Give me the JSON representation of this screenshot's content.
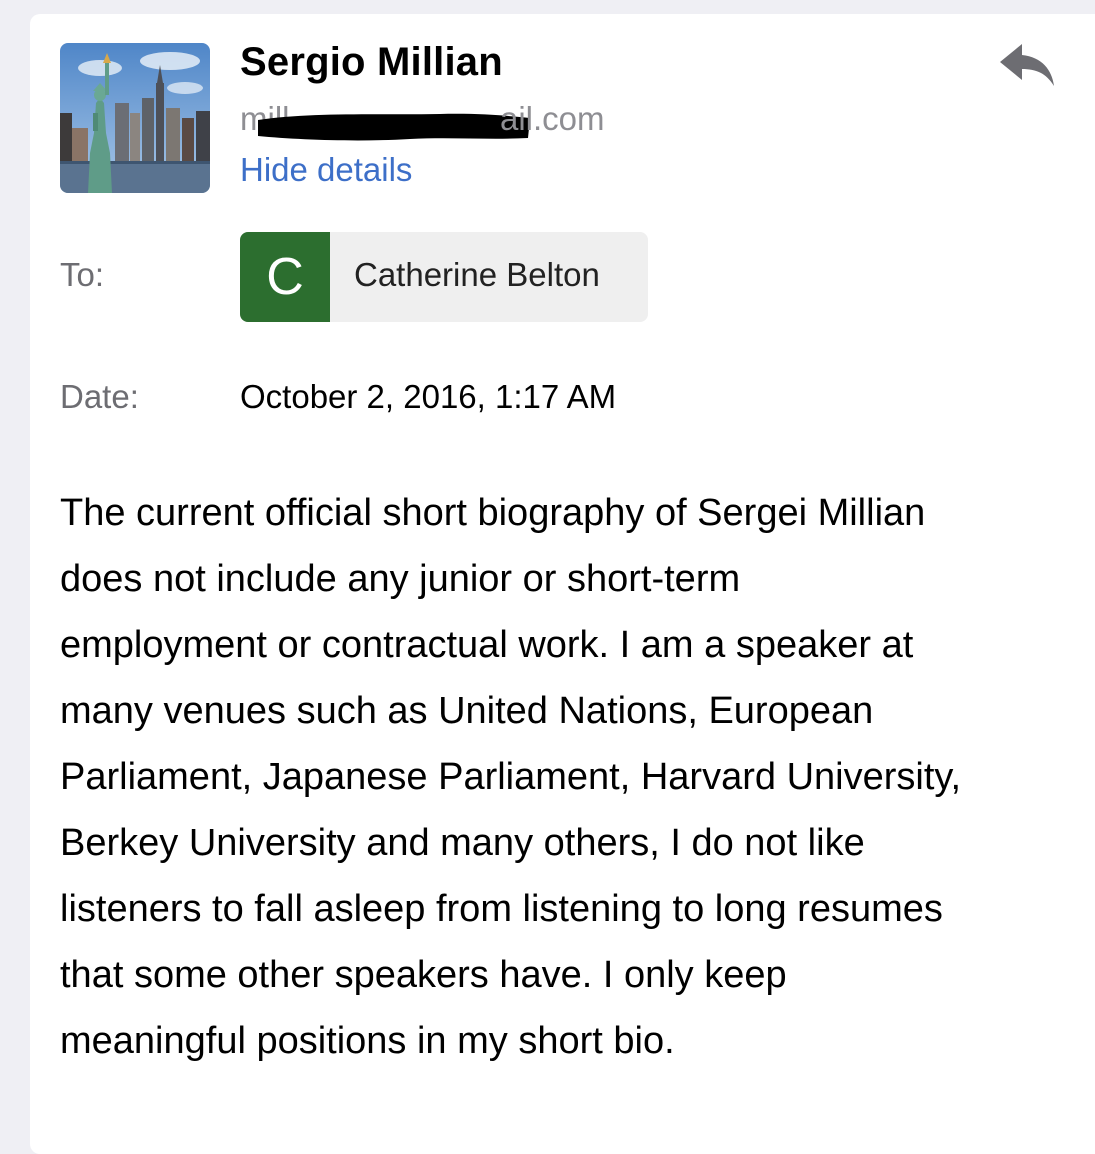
{
  "sender": {
    "name": "Sergio Millian",
    "email_prefix_visible": "mill",
    "email_suffix_visible": "ail.com",
    "hide_details_label": "Hide details"
  },
  "recipients": {
    "label": "To:",
    "items": [
      {
        "initial": "C",
        "name": "Catherine Belton",
        "color": "#2c6e2f"
      }
    ]
  },
  "date": {
    "label": "Date:",
    "value": "October 2, 2016, 1:17 AM"
  },
  "body": {
    "lines": [
      "The current official short biography of Sergei Millian",
      "does not include any junior or short-term",
      "employment or contractual work. I am a speaker at",
      "many venues such as United Nations, European",
      "Parliament, Japanese Parliament, Harvard University,",
      "Berkey University and many others, I do not like",
      "listeners to fall asleep from listening to long resumes",
      "that some other speakers have. I only keep",
      "meaningful positions in my short bio."
    ]
  },
  "icons": {
    "reply": "reply-arrow-icon",
    "avatar": "statue-of-liberty-photo"
  },
  "colors": {
    "link": "#3d6fc8",
    "secondary_text": "#8e8e93",
    "chip_background": "#efefef"
  }
}
